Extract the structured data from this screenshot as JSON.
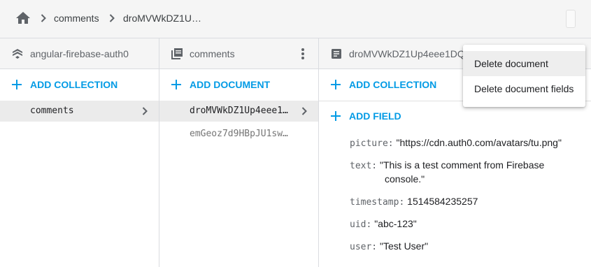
{
  "breadcrumb": {
    "home_icon": "home-icon",
    "items": [
      "comments",
      "droMVWkDZ1U…"
    ]
  },
  "panels": {
    "root": {
      "title": "angular-firebase-auth0",
      "icon": "firestore-icon",
      "add_label": "ADD COLLECTION",
      "items": [
        {
          "label": "comments",
          "selected": true
        }
      ]
    },
    "collection": {
      "title": "comments",
      "icon": "collection-icon",
      "add_label": "ADD DOCUMENT",
      "items": [
        {
          "label": "droMVWkDZ1Up4eee1…",
          "selected": true
        },
        {
          "label": "emGeoz7d9HBpJU1sw…",
          "selected": false
        }
      ]
    },
    "document": {
      "title": "droMVWkDZ1Up4eee1DQ…",
      "icon": "document-icon",
      "add_collection_label": "ADD COLLECTION",
      "add_field_label": "ADD FIELD",
      "fields": [
        {
          "key": "picture:",
          "value": "\"https://cdn.auth0.com/avatars/tu.png\""
        },
        {
          "key": "text:",
          "value_line1": "\"This is a test comment from Firebase",
          "value_line2": "console.\""
        },
        {
          "key": "timestamp:",
          "value": "1514584235257"
        },
        {
          "key": "uid:",
          "value": "\"abc-123\""
        },
        {
          "key": "user:",
          "value": "\"Test User\""
        }
      ]
    }
  },
  "menu": {
    "items": [
      "Delete document",
      "Delete document fields"
    ],
    "hovered_index": 0
  },
  "colors": {
    "accent": "#039be5",
    "header_bg": "#f5f5f5",
    "selected_bg": "#ebebeb"
  }
}
